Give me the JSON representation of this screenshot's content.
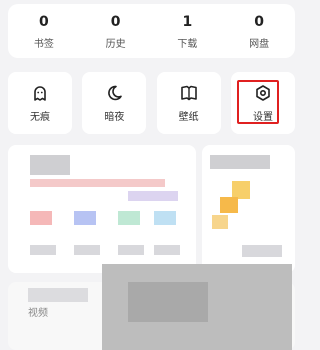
{
  "stats": [
    {
      "value": "0",
      "label": "书签"
    },
    {
      "value": "0",
      "label": "历史"
    },
    {
      "value": "1",
      "label": "下载"
    },
    {
      "value": "0",
      "label": "网盘"
    }
  ],
  "quick_actions": [
    {
      "label": "无痕",
      "icon": "ghost-icon"
    },
    {
      "label": "暗夜",
      "icon": "moon-icon"
    },
    {
      "label": "壁纸",
      "icon": "book-open-icon"
    },
    {
      "label": "设置",
      "icon": "settings-hexagon-icon"
    }
  ],
  "highlight_color": "#e02020",
  "bottom_label": "视频"
}
